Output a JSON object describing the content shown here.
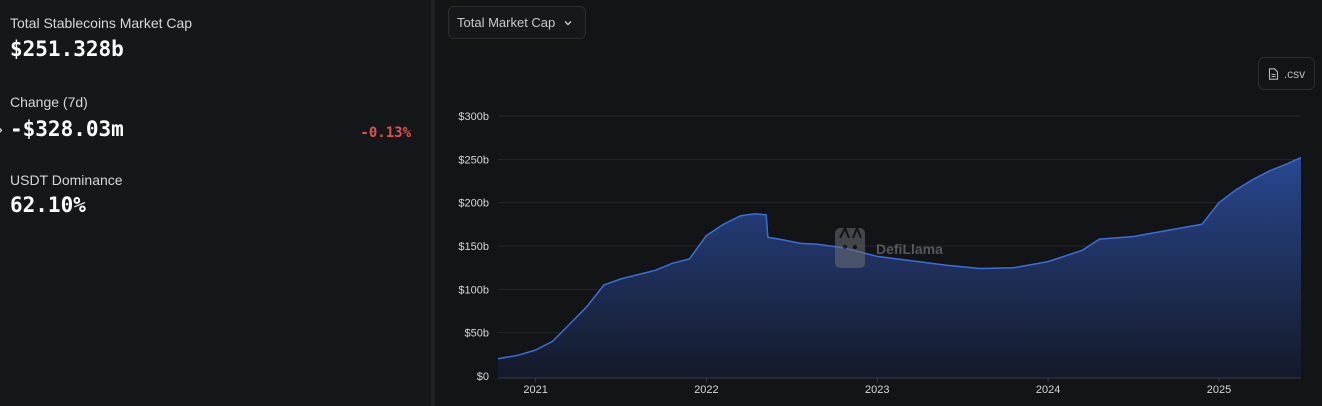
{
  "stats": {
    "market_cap_label": "Total Stablecoins Market Cap",
    "market_cap_value": "$251.328b",
    "change_label": "Change (7d)",
    "change_value": "-$328.03m",
    "change_pct": "-0.13%",
    "dominance_label": "USDT Dominance",
    "dominance_value": "62.10%"
  },
  "toolbar": {
    "dropdown_label": "Total Market Cap",
    "csv_label": ".csv"
  },
  "watermark": {
    "text": "DefiLlama"
  },
  "colors": {
    "negative": "#e0524f",
    "line": "#3b6fd8",
    "area_top": "#2a4a96",
    "area_bottom": "#141a2b"
  },
  "icons": {
    "dropdown": "chevron-down-icon",
    "csv": "file-icon",
    "caret": "caret-right-icon",
    "watermark": "llama-logo-icon"
  },
  "chart_data": {
    "type": "area",
    "series_name": "Total Market Cap",
    "yticks": [
      "$0",
      "$50b",
      "$100b",
      "$150b",
      "$200b",
      "$250b",
      "$300b"
    ],
    "xticks": [
      "2021",
      "2022",
      "2023",
      "2024",
      "2025"
    ],
    "ylim": [
      0,
      300
    ],
    "x_range_years": [
      2020.78,
      2025.48
    ],
    "grid": true,
    "points": [
      [
        2020.78,
        20
      ],
      [
        2020.9,
        24
      ],
      [
        2021.0,
        30
      ],
      [
        2021.1,
        40
      ],
      [
        2021.2,
        60
      ],
      [
        2021.3,
        80
      ],
      [
        2021.4,
        105
      ],
      [
        2021.5,
        112
      ],
      [
        2021.6,
        117
      ],
      [
        2021.7,
        122
      ],
      [
        2021.8,
        130
      ],
      [
        2021.9,
        135
      ],
      [
        2022.0,
        162
      ],
      [
        2022.1,
        175
      ],
      [
        2022.2,
        185
      ],
      [
        2022.28,
        187
      ],
      [
        2022.35,
        186
      ],
      [
        2022.36,
        160
      ],
      [
        2022.45,
        157
      ],
      [
        2022.55,
        153
      ],
      [
        2022.65,
        152
      ],
      [
        2022.8,
        148
      ],
      [
        2023.0,
        138
      ],
      [
        2023.2,
        133
      ],
      [
        2023.4,
        128
      ],
      [
        2023.6,
        124
      ],
      [
        2023.8,
        125
      ],
      [
        2024.0,
        132
      ],
      [
        2024.2,
        145
      ],
      [
        2024.3,
        158
      ],
      [
        2024.5,
        161
      ],
      [
        2024.7,
        168
      ],
      [
        2024.9,
        175
      ],
      [
        2025.0,
        200
      ],
      [
        2025.1,
        215
      ],
      [
        2025.2,
        227
      ],
      [
        2025.3,
        237
      ],
      [
        2025.4,
        245
      ],
      [
        2025.48,
        252
      ]
    ]
  }
}
